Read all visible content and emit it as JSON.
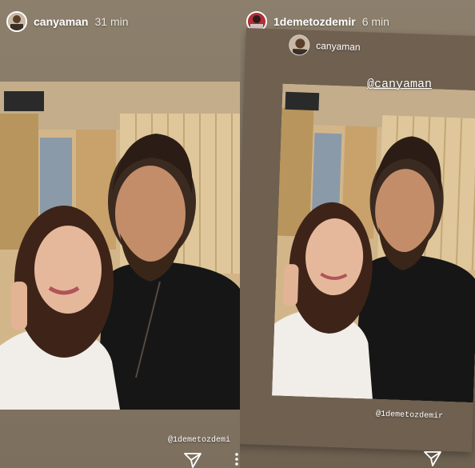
{
  "left_story": {
    "username": "canyaman",
    "time": "31 min",
    "mention": "@1demetozdemi"
  },
  "right_story": {
    "username": "1demetozdemir",
    "time": "6 min",
    "reposted_from": "canyaman",
    "mention_top": "@canyaman",
    "mention_bottom": "@1demetozdemir"
  },
  "icons": {
    "share": "paper-plane-icon",
    "more": "more-options-icon"
  },
  "colors": {
    "background_brown": "#8a7d6a",
    "text": "#ffffff"
  }
}
